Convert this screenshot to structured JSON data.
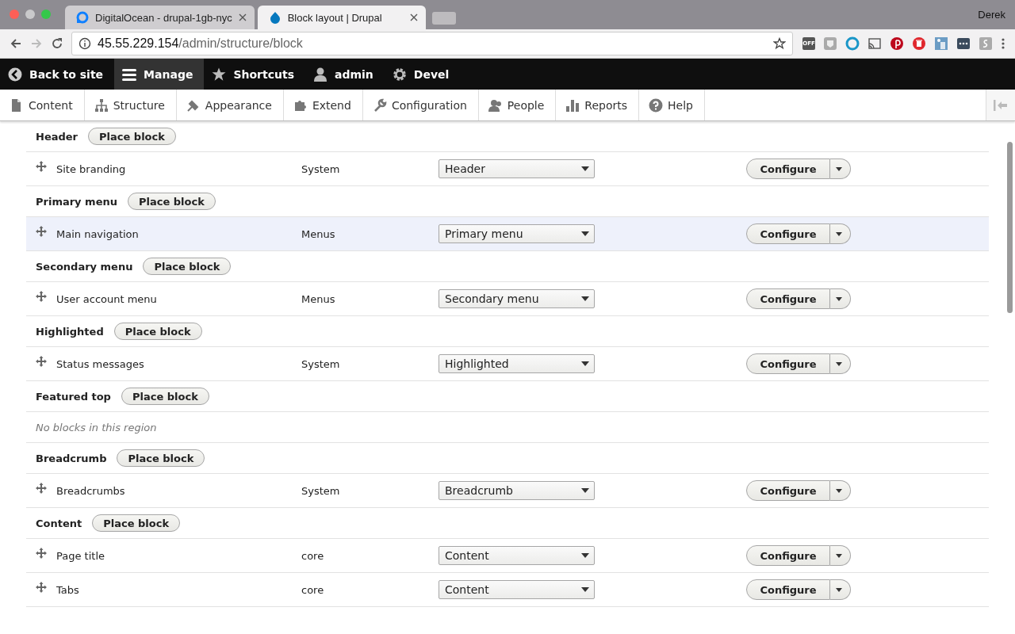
{
  "browser": {
    "tabs": [
      {
        "title": "DigitalOcean - drupal-1gb-nyc",
        "selected": false
      },
      {
        "title": "Block layout | Drupal",
        "selected": true
      }
    ],
    "user": "Derek",
    "address": {
      "host": "45.55.229.154",
      "path": "/admin/structure/block"
    },
    "extension_label": "OFF"
  },
  "toolbar": {
    "items": [
      {
        "label": "Back to site",
        "selected": false
      },
      {
        "label": "Manage",
        "selected": true
      },
      {
        "label": "Shortcuts",
        "selected": false
      },
      {
        "label": "admin",
        "selected": false
      },
      {
        "label": "Devel",
        "selected": false
      }
    ]
  },
  "tray": {
    "items": [
      {
        "label": "Content"
      },
      {
        "label": "Structure"
      },
      {
        "label": "Appearance"
      },
      {
        "label": "Extend"
      },
      {
        "label": "Configuration"
      },
      {
        "label": "People"
      },
      {
        "label": "Reports"
      },
      {
        "label": "Help"
      }
    ]
  },
  "regions": [
    {
      "title": "Header",
      "button": "Place block",
      "blocks": [
        {
          "name": "Site branding",
          "category": "System",
          "region": "Header",
          "action": "Configure",
          "hovered": false
        }
      ]
    },
    {
      "title": "Primary menu",
      "button": "Place block",
      "blocks": [
        {
          "name": "Main navigation",
          "category": "Menus",
          "region": "Primary menu",
          "action": "Configure",
          "hovered": true
        }
      ]
    },
    {
      "title": "Secondary menu",
      "button": "Place block",
      "blocks": [
        {
          "name": "User account menu",
          "category": "Menus",
          "region": "Secondary menu",
          "action": "Configure",
          "hovered": false
        }
      ]
    },
    {
      "title": "Highlighted",
      "button": "Place block",
      "blocks": [
        {
          "name": "Status messages",
          "category": "System",
          "region": "Highlighted",
          "action": "Configure",
          "hovered": false
        }
      ]
    },
    {
      "title": "Featured top",
      "button": "Place block",
      "empty": "No blocks in this region"
    },
    {
      "title": "Breadcrumb",
      "button": "Place block",
      "blocks": [
        {
          "name": "Breadcrumbs",
          "category": "System",
          "region": "Breadcrumb",
          "action": "Configure",
          "hovered": false
        }
      ]
    },
    {
      "title": "Content",
      "button": "Place block",
      "blocks": [
        {
          "name": "Page title",
          "category": "core",
          "region": "Content",
          "action": "Configure",
          "hovered": false
        },
        {
          "name": "Tabs",
          "category": "core",
          "region": "Content",
          "action": "Configure",
          "hovered": false
        }
      ]
    }
  ]
}
